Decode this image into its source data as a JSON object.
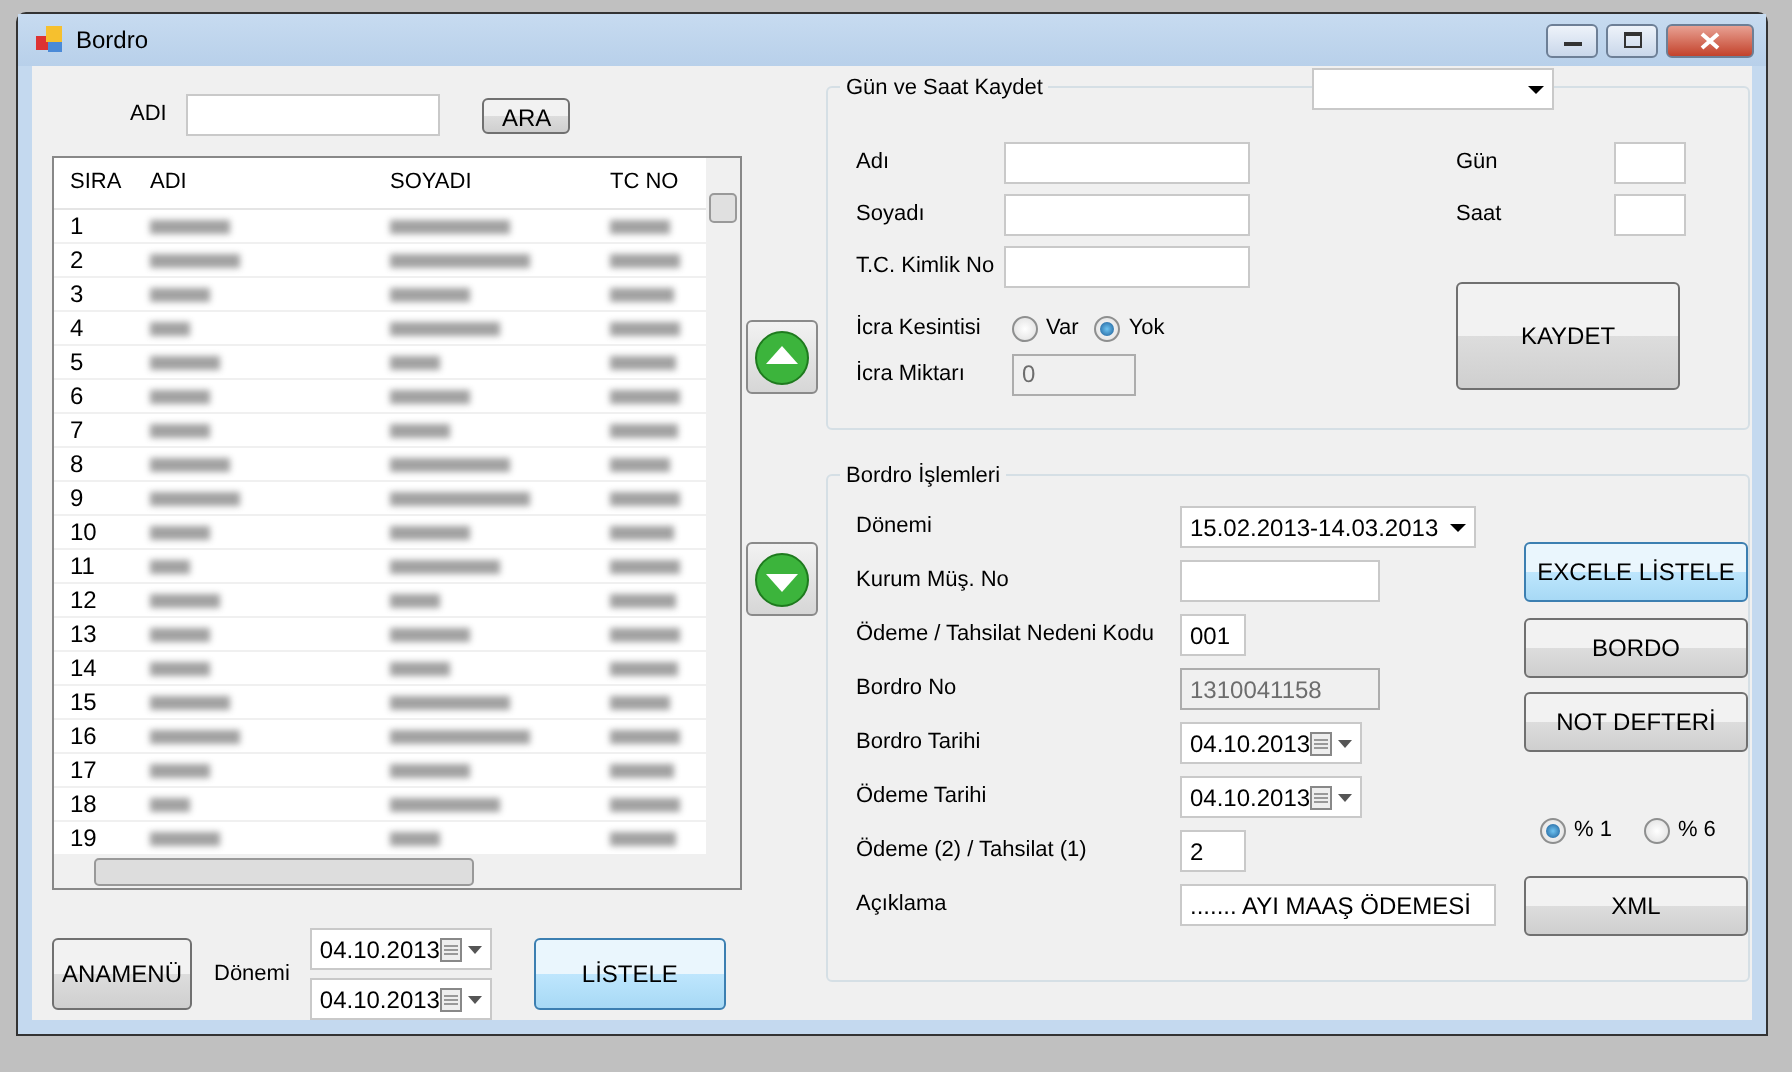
{
  "window": {
    "title": "Bordro"
  },
  "search": {
    "label": "ADI",
    "button": "ARA"
  },
  "table": {
    "columns": [
      "SIRA",
      "ADI",
      "SOYADI",
      "TC NO"
    ],
    "rows": [
      {
        "sira": "1"
      },
      {
        "sira": "2"
      },
      {
        "sira": "3"
      },
      {
        "sira": "4"
      },
      {
        "sira": "5"
      },
      {
        "sira": "6"
      },
      {
        "sira": "7"
      },
      {
        "sira": "8"
      },
      {
        "sira": "9"
      },
      {
        "sira": "10"
      },
      {
        "sira": "11"
      },
      {
        "sira": "12"
      },
      {
        "sira": "13"
      },
      {
        "sira": "14"
      },
      {
        "sira": "15"
      },
      {
        "sira": "16"
      },
      {
        "sira": "17"
      },
      {
        "sira": "18"
      },
      {
        "sira": "19"
      }
    ]
  },
  "bottom": {
    "menu_button": "ANAMENÜ",
    "period_label": "Dönemi",
    "dates": [
      "04.10.2013",
      "04.10.2013"
    ],
    "list_button": {
      "label": "LİSTELE",
      "focused": true
    }
  },
  "record_group": {
    "title": "Gün ve Saat Kaydet",
    "fields": [
      {
        "label": "Adı"
      },
      {
        "label": "Soyadı"
      },
      {
        "label": "T.C. Kimlik No"
      }
    ],
    "day_label": "Gün",
    "hour_label": "Saat",
    "save_button": "KAYDET",
    "deduction": {
      "label": "İcra Kesintisi",
      "options": [
        {
          "label": "Var",
          "selected": false
        },
        {
          "label": "Yok",
          "selected": true
        }
      ]
    },
    "amount": {
      "label": "İcra Miktarı",
      "value": "0",
      "disabled": true
    }
  },
  "payroll_group": {
    "title": "Bordro İşlemleri",
    "fields": [
      {
        "kind": "dropdown",
        "label": "Dönemi",
        "value": "15.02.2013-14.03.2013"
      },
      {
        "kind": "text",
        "label": "Kurum Müş. No"
      },
      {
        "kind": "short",
        "label": "Ödeme / Tahsilat Nedeni Kodu",
        "value": "001"
      },
      {
        "kind": "readonly",
        "label": "Bordro No",
        "value": "1310041158"
      },
      {
        "kind": "date",
        "label": "Bordro Tarihi",
        "value": "04.10.2013"
      },
      {
        "kind": "date",
        "label": "Ödeme Tarihi",
        "value": "04.10.2013"
      },
      {
        "kind": "short",
        "label": "Ödeme (2) / Tahsilat (1)",
        "value": "2"
      },
      {
        "kind": "wide",
        "label": "Açıklama",
        "value": "....... AYI MAAŞ ÖDEMESİ"
      }
    ],
    "buttons": [
      {
        "label": "EXCELE LİSTELE",
        "focused": true
      },
      {
        "label": "BORDO",
        "focused": false
      },
      {
        "label": "NOT DEFTERİ",
        "focused": false
      }
    ],
    "rates": [
      {
        "label": "% 1",
        "selected": true
      },
      {
        "label": "% 6",
        "selected": false
      }
    ],
    "xml_button": "XML"
  }
}
